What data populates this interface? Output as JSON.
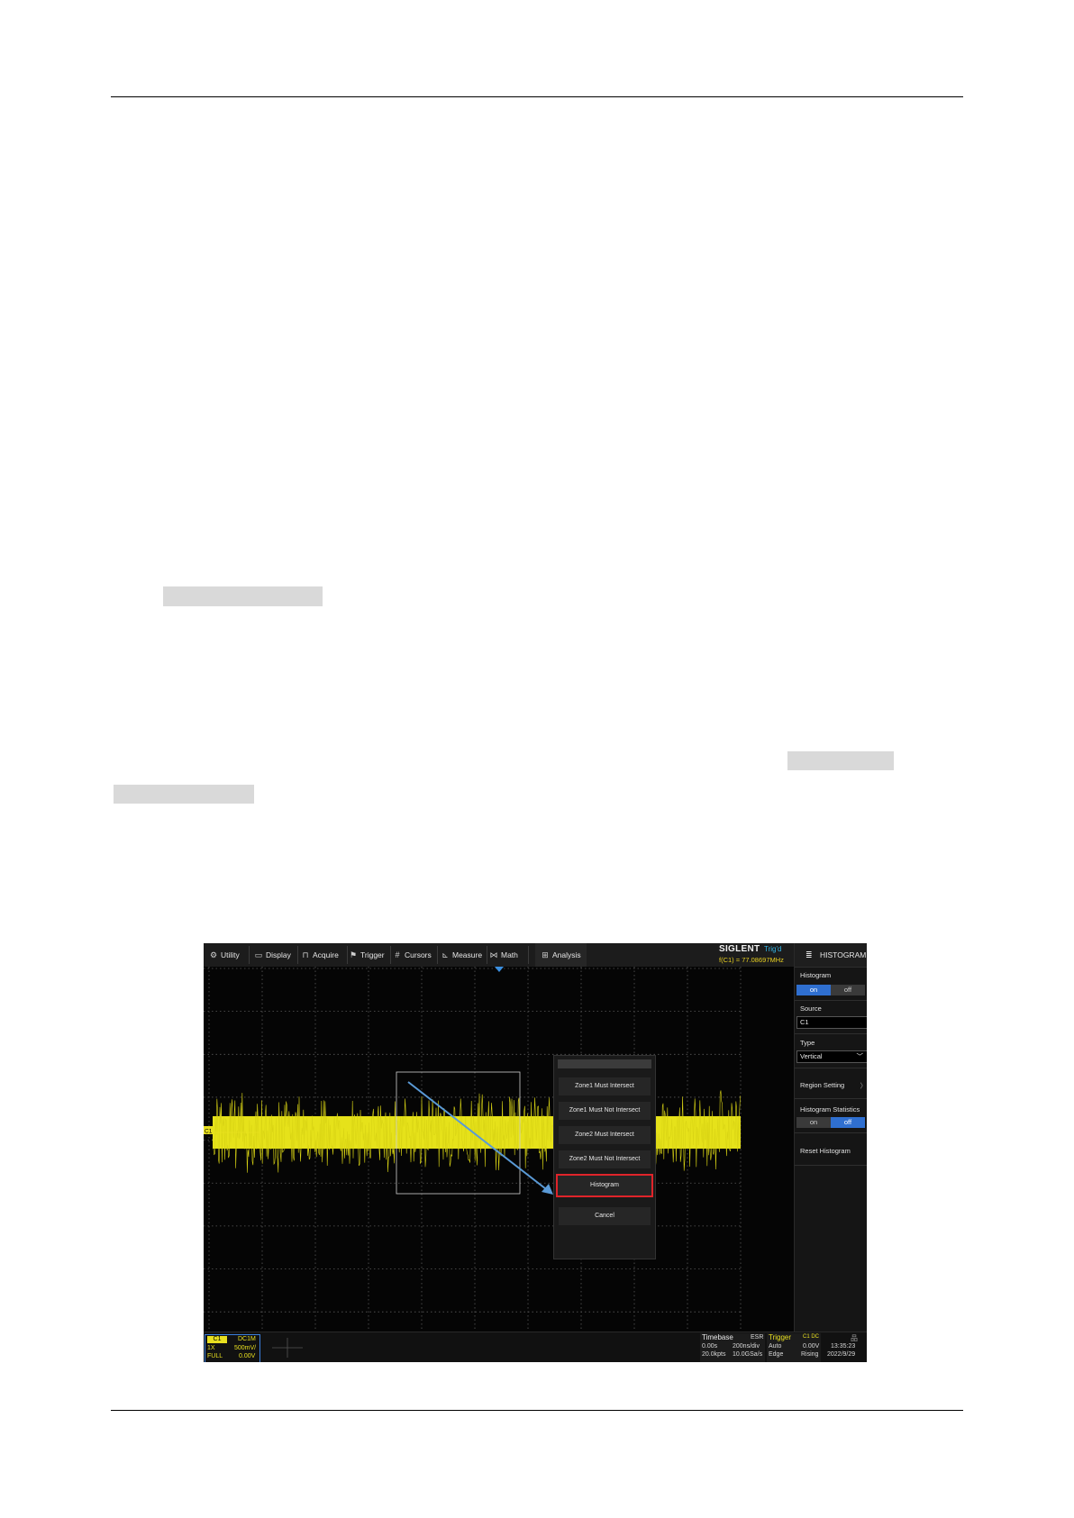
{
  "page": {
    "redactions": [
      "",
      "",
      ""
    ]
  },
  "scope": {
    "menu": [
      {
        "icon": "utility-icon",
        "glyph": "⚙",
        "label": "Utility"
      },
      {
        "icon": "display-icon",
        "glyph": "▭",
        "label": "Display"
      },
      {
        "icon": "acquire-icon",
        "glyph": "⊓",
        "label": "Acquire"
      },
      {
        "icon": "trigger-icon",
        "glyph": "⚑",
        "label": "Trigger"
      },
      {
        "icon": "cursors-icon",
        "glyph": "#",
        "label": "Cursors"
      },
      {
        "icon": "measure-icon",
        "glyph": "⊾",
        "label": "Measure"
      },
      {
        "icon": "math-icon",
        "glyph": "⋈",
        "label": "Math"
      },
      {
        "icon": "analysis-icon",
        "glyph": "⊞",
        "label": "Analysis"
      }
    ],
    "brand": {
      "logo": "SIGLENT",
      "trig_status": "Trig'd",
      "frequency": "f(C1) = 77.08697MHz"
    },
    "sidebar": {
      "header_icon": "≣",
      "header": "HISTOGRAM",
      "histogram_label": "Histogram",
      "histogram_on": "on",
      "histogram_off": "off",
      "histogram_state": "on",
      "source_label": "Source",
      "source_value": "C1",
      "type_label": "Type",
      "type_value": "Vertical",
      "region_setting": "Region Setting",
      "stats_label": "Histogram Statistics",
      "stats_on": "on",
      "stats_off": "off",
      "stats_state": "off",
      "reset": "Reset Histogram"
    },
    "dialog": {
      "options": [
        "Zone1 Must Intersect",
        "Zone1 Must Not Intersect",
        "Zone2 Must Intersect",
        "Zone2 Must Not Intersect",
        "Histogram",
        "Cancel"
      ],
      "highlighted": "Histogram"
    },
    "channel_marker": "C1",
    "status": {
      "c1": {
        "name": "C1",
        "coupling": "DC1M",
        "probe": "1X",
        "scale": "500mV/",
        "bw": "FULL",
        "offset": "0.00V"
      },
      "timebase": {
        "label": "Timebase",
        "mode": "ESR",
        "delay": "0.00s",
        "scale": "200ns/div",
        "points": "20.0kpts",
        "rate": "10.0GSa/s"
      },
      "trigger": {
        "label": "Trigger",
        "source": "C1 DC",
        "mode": "Auto",
        "level": "0.00V",
        "type": "Edge",
        "slope": "Rising"
      },
      "clock": {
        "time": "13:35:23",
        "date": "2022/9/29"
      }
    }
  }
}
